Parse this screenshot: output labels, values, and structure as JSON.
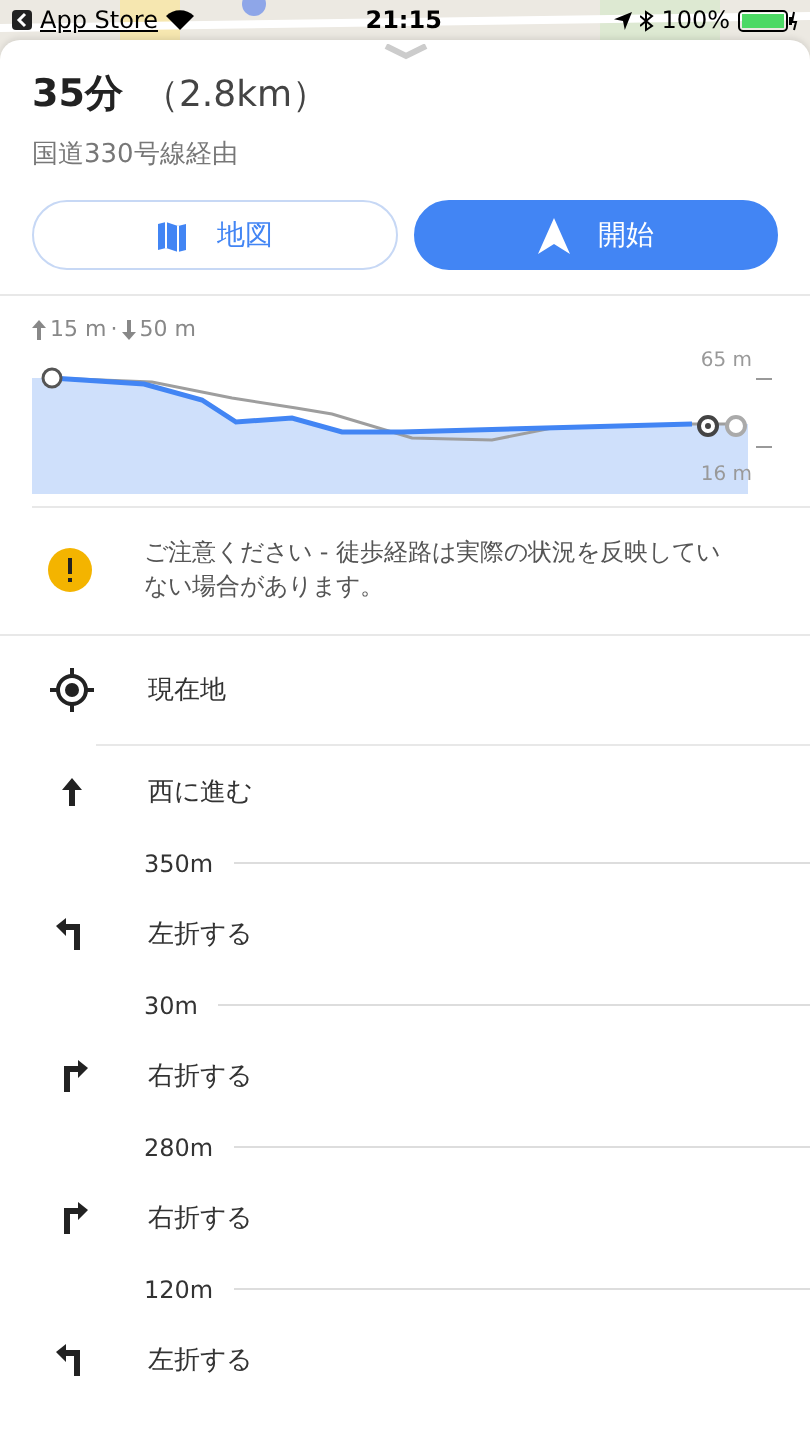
{
  "status_bar": {
    "back_label": "App Store",
    "time": "21:15",
    "battery": "100%"
  },
  "summary": {
    "duration": "35分",
    "distance": "（2.8km）",
    "via": "国道330号線経由"
  },
  "buttons": [
    {
      "kind": "map",
      "label": "地図"
    },
    {
      "kind": "start",
      "label": "開始"
    }
  ],
  "elevation": {
    "summary_up": "15 m",
    "separator": "·",
    "summary_down": "50 m",
    "high_label": "65 m",
    "low_label": "16 m"
  },
  "warning": "ご注意ください - 徒歩経路は実際の状況を反映していない場合があります。",
  "steps": [
    {
      "kind": "current",
      "label": "現在地"
    },
    {
      "kind": "straight",
      "label": "西に進む",
      "distance": "350m"
    },
    {
      "kind": "left",
      "label": "左折する",
      "distance": "30m"
    },
    {
      "kind": "right",
      "label": "右折する",
      "distance": "280m"
    },
    {
      "kind": "right",
      "label": "右折する",
      "distance": "120m"
    },
    {
      "kind": "left",
      "label": "左折する"
    }
  ]
}
